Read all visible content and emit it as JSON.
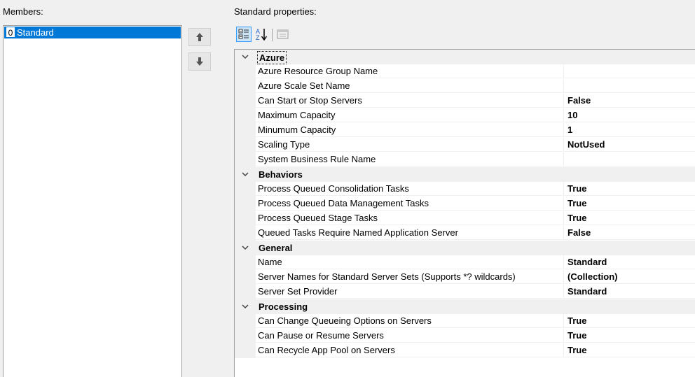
{
  "members": {
    "label": "Members:",
    "items": [
      {
        "index": "0",
        "name": "Standard"
      }
    ]
  },
  "buttons": {
    "move_up": "arrow-up-icon",
    "move_down": "arrow-down-icon"
  },
  "properties": {
    "label": "Standard properties:",
    "toolbar": [
      "categorized-icon",
      "alphabetical-icon",
      "property-pages-icon"
    ],
    "categories": [
      {
        "name": "Azure",
        "rows": [
          {
            "name": "Azure Resource Group Name",
            "value": ""
          },
          {
            "name": "Azure Scale Set Name",
            "value": ""
          },
          {
            "name": "Can Start or Stop Servers",
            "value": "False"
          },
          {
            "name": "Maximum Capacity",
            "value": "10"
          },
          {
            "name": "Minumum Capacity",
            "value": "1"
          },
          {
            "name": "Scaling Type",
            "value": "NotUsed"
          },
          {
            "name": "System Business Rule Name",
            "value": ""
          }
        ]
      },
      {
        "name": "Behaviors",
        "rows": [
          {
            "name": "Process Queued Consolidation Tasks",
            "value": "True"
          },
          {
            "name": "Process Queued Data Management Tasks",
            "value": "True"
          },
          {
            "name": "Process Queued Stage Tasks",
            "value": "True"
          },
          {
            "name": "Queued Tasks Require Named Application Server",
            "value": "False"
          }
        ]
      },
      {
        "name": "General",
        "rows": [
          {
            "name": "Name",
            "value": "Standard"
          },
          {
            "name": "Server Names for Standard Server Sets (Supports *? wildcards)",
            "value": "(Collection)"
          },
          {
            "name": "Server Set Provider",
            "value": "Standard"
          }
        ]
      },
      {
        "name": "Processing",
        "rows": [
          {
            "name": "Can Change Queueing Options on Servers",
            "value": "True"
          },
          {
            "name": "Can Pause or Resume Servers",
            "value": "True"
          },
          {
            "name": "Can Recycle App Pool on Servers",
            "value": "True"
          }
        ]
      }
    ]
  },
  "colors": {
    "selection": "#0078d7",
    "panel": "#f0f0f0",
    "grid_line": "#f0f0f0"
  }
}
